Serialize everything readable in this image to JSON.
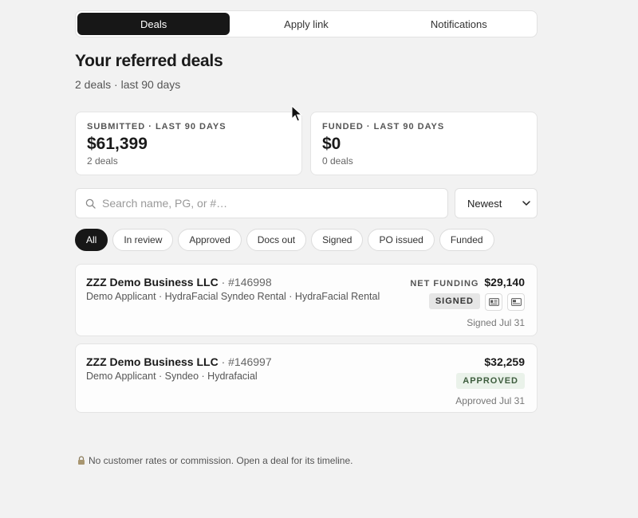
{
  "tabs": [
    {
      "label": "Deals",
      "active": true
    },
    {
      "label": "Apply link",
      "active": false
    },
    {
      "label": "Notifications",
      "active": false
    }
  ],
  "page": {
    "title": "Your referred deals",
    "subtitle": "2 deals · last 90 days"
  },
  "stats": [
    {
      "label": "SUBMITTED · LAST 90 DAYS",
      "value": "$61,399",
      "sub": "2 deals"
    },
    {
      "label": "FUNDED · LAST 90 DAYS",
      "value": "$0",
      "sub": "0 deals"
    }
  ],
  "search": {
    "placeholder": "Search name, PG, or #…",
    "value": ""
  },
  "sort": {
    "selected": "Newest"
  },
  "filters": [
    {
      "label": "All",
      "active": true
    },
    {
      "label": "In review",
      "active": false
    },
    {
      "label": "Approved",
      "active": false
    },
    {
      "label": "Docs out",
      "active": false
    },
    {
      "label": "Signed",
      "active": false
    },
    {
      "label": "PO issued",
      "active": false
    },
    {
      "label": "Funded",
      "active": false
    }
  ],
  "deals": [
    {
      "name": "ZZZ Demo Business LLC",
      "number": "· #146998",
      "meta": "Demo Applicant · HydraFacial Syndeo Rental · HydraFacial Rental",
      "amount_label": "NET FUNDING",
      "amount": "$29,140",
      "status": "SIGNED",
      "date": "Signed Jul 31",
      "icons": [
        "id-card-icon",
        "card-icon"
      ]
    },
    {
      "name": "ZZZ Demo Business LLC",
      "number": "· #146997",
      "meta": "Demo Applicant · Syndeo · Hydrafacial",
      "amount_label": "",
      "amount": "$32,259",
      "status": "APPROVED",
      "date": "Approved Jul 31",
      "icons": []
    }
  ],
  "footer": {
    "icon": "lock-icon",
    "text": "No customer rates or commission. Open a deal for its timeline."
  }
}
